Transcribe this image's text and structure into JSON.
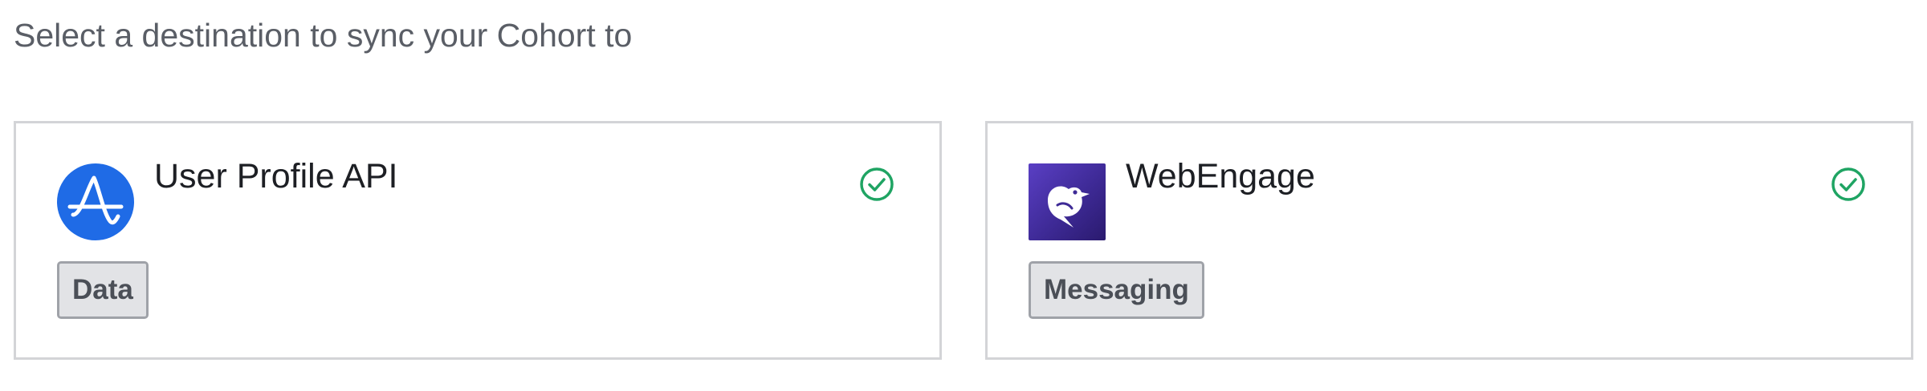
{
  "heading": "Select a destination to sync your Cohort to",
  "colors": {
    "accent_blue": "#1f6be6",
    "check_green": "#1fa463",
    "border": "#d3d4d7",
    "tag_bg": "#e2e3e6"
  },
  "destinations": [
    {
      "name": "User Profile API",
      "tag": "Data",
      "icon": "amplitude-logo-icon",
      "selected_status_icon": "check-circle-icon"
    },
    {
      "name": "WebEngage",
      "tag": "Messaging",
      "icon": "webengage-logo-icon",
      "selected_status_icon": "check-circle-icon"
    }
  ]
}
